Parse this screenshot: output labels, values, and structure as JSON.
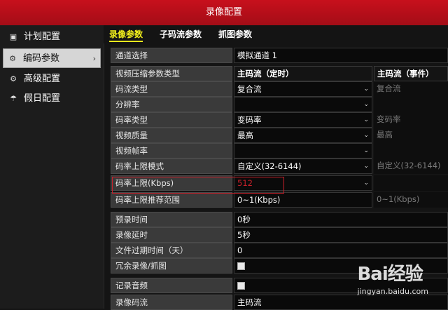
{
  "window": {
    "title": "录像配置"
  },
  "sidebar": {
    "items": [
      {
        "label": "计划配置",
        "icon": "square-icon"
      },
      {
        "label": "编码参数",
        "icon": "gear-icon",
        "active": true
      },
      {
        "label": "高级配置",
        "icon": "gear-icon"
      },
      {
        "label": "假日配置",
        "icon": "umbrella-icon"
      }
    ]
  },
  "tabs": [
    {
      "label": "录像参数",
      "active": true
    },
    {
      "label": "子码流参数"
    },
    {
      "label": "抓图参数"
    }
  ],
  "form": {
    "channel": {
      "label": "通道选择",
      "value": "模拟通道 1"
    },
    "header": {
      "label": "视频压缩参数类型",
      "main": "主码流（定时）",
      "event": "主码流（事件）"
    },
    "rows": [
      {
        "label": "码流类型",
        "main": "复合流",
        "event": "复合流"
      },
      {
        "label": "分辨率",
        "main": "",
        "event": ""
      },
      {
        "label": "码率类型",
        "main": "变码率",
        "event": "变码率"
      },
      {
        "label": "视频质量",
        "main": "最高",
        "event": "最高"
      },
      {
        "label": "视频帧率",
        "main": "",
        "event": ""
      },
      {
        "label": "码率上限模式",
        "main": "自定义(32-6144)",
        "event": "自定义(32-6144)"
      },
      {
        "label": "码率上限(Kbps)",
        "main": "512",
        "event": ""
      },
      {
        "label": "码率上限推荐范围",
        "main": "0~1(Kbps)",
        "event": "0~1(Kbps)"
      }
    ],
    "prerecord": {
      "label": "预录时间",
      "value": "0秒"
    },
    "postrecord": {
      "label": "录像延时",
      "value": "5秒"
    },
    "expire": {
      "label": "文件过期时间（天）",
      "value": "0"
    },
    "redundant": {
      "label": "冗余录像/抓图",
      "checked": false
    },
    "audio": {
      "label": "记录音频",
      "checked": false
    },
    "stream": {
      "label": "录像码流",
      "value": "主码流"
    }
  },
  "watermark": {
    "logo": "Bai经验",
    "url": "jingyan.baidu.com"
  },
  "colors": {
    "titlebar": "#b30f1a",
    "active_tab": "#f2ef1c",
    "highlight": "#c8202a"
  }
}
